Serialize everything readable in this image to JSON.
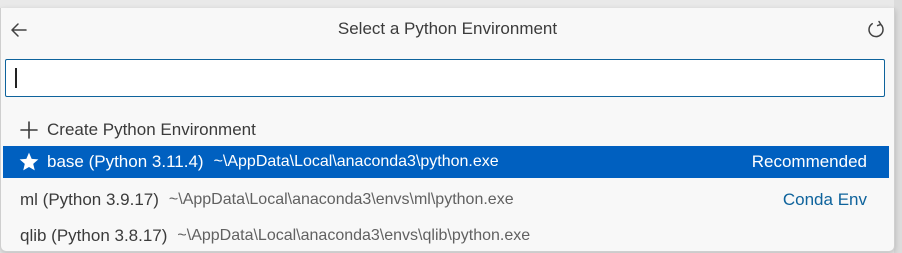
{
  "picker": {
    "title": "Select a Python Environment",
    "search_value": "",
    "search_placeholder": ""
  },
  "items": [
    {
      "label": "Create Python Environment",
      "description": "",
      "tag": "",
      "icon": "plus-icon"
    },
    {
      "label": "base (Python 3.11.4)",
      "description": "~\\AppData\\Local\\anaconda3\\python.exe",
      "tag": "Recommended",
      "icon": "star-icon"
    },
    {
      "label": "ml (Python 3.9.17)",
      "description": "~\\AppData\\Local\\anaconda3\\envs\\ml\\python.exe",
      "tag": "Conda Env",
      "icon": ""
    },
    {
      "label": "qlib (Python 3.8.17)",
      "description": "~\\AppData\\Local\\anaconda3\\envs\\qlib\\python.exe",
      "tag": "",
      "icon": ""
    }
  ],
  "colors": {
    "selection": "#0060c0",
    "accent": "#0e639c"
  }
}
